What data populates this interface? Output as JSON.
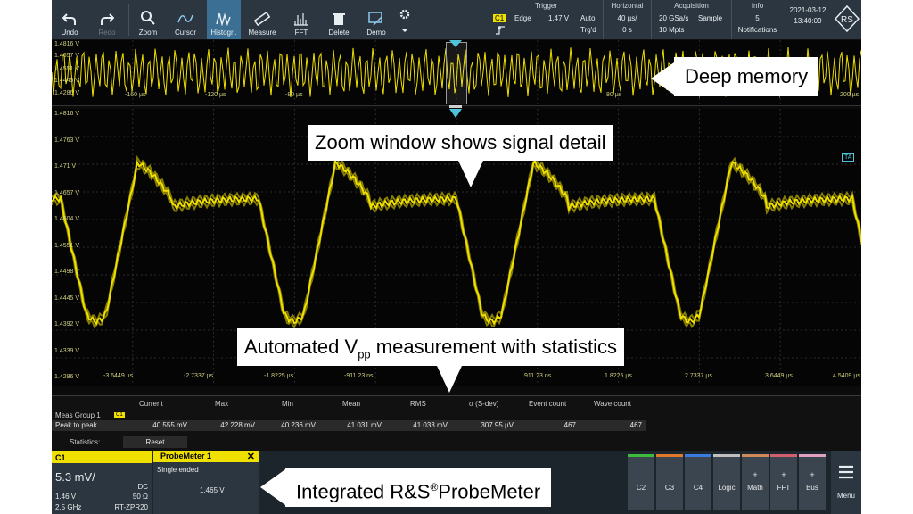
{
  "toolbar": {
    "items": [
      {
        "label": "Undo",
        "icon": "undo-icon"
      },
      {
        "label": "Redo",
        "icon": "redo-icon"
      },
      {
        "label": "Zoom",
        "icon": "zoom-icon"
      },
      {
        "label": "Cursor",
        "icon": "cursor-icon"
      },
      {
        "label": "Histogr..",
        "icon": "histogram-icon"
      },
      {
        "label": "Measure",
        "icon": "measure-icon"
      },
      {
        "label": "FFT",
        "icon": "fft-icon"
      },
      {
        "label": "Delete",
        "icon": "delete-icon"
      },
      {
        "label": "Demo",
        "icon": "demo-icon"
      }
    ]
  },
  "trigger": {
    "header": "Trigger",
    "channel": "C1",
    "type": "Edge",
    "level": "1.47 V",
    "mode": "Auto",
    "state": "Trg'd"
  },
  "horizontal": {
    "header": "Horizontal",
    "scale": "40 µs/",
    "position": "0 s"
  },
  "acquisition": {
    "header": "Acquisition",
    "rate": "20 GSa/s",
    "mode": "Sample",
    "points": "10 Mpts"
  },
  "info": {
    "header": "Info",
    "count": "5",
    "label": "Notifications"
  },
  "datetime": {
    "date": "2021-03-12",
    "time": "13:40:09"
  },
  "overview": {
    "vlabels": [
      "1.4816 V",
      "1.4657 V",
      "1.4551 V",
      "1.4445 V",
      "1.4286 V"
    ],
    "tlabels": [
      "-160 µs",
      "-120 µs",
      "-80 µs",
      "80 µs",
      "120 µs",
      "160 µs",
      "200 µs"
    ]
  },
  "main": {
    "vlabels": [
      "1.4816 V",
      "1.4763 V",
      "1.471 V",
      "1.4657 V",
      "1.4604 V",
      "1.4551 V",
      "1.4498 V",
      "1.4445 V",
      "1.4392 V",
      "1.4339 V",
      "1.4286 V"
    ],
    "tlabels": [
      "-3.6449 µs",
      "-2.7337 µs",
      "-1.8225 µs",
      "-911.23 ns",
      "911.23 ns",
      "1.8225 µs",
      "2.7337 µs",
      "3.6449 µs",
      "4.5409 µs"
    ],
    "marker": "TA"
  },
  "measurements": {
    "headers": [
      "Current",
      "Max",
      "Min",
      "Mean",
      "RMS",
      "σ (S-dev)",
      "Event count",
      "Wave count"
    ],
    "group": "Meas Group 1",
    "group_badge": "C1",
    "row_label": "Peak to peak",
    "values": [
      "40.555 mV",
      "42.228 mV",
      "40.236 mV",
      "41.031 mV",
      "41.033 mV",
      "307.95 µV",
      "467",
      "467"
    ],
    "statistics_label": "Statistics:",
    "reset_label": "Reset"
  },
  "channel1": {
    "name": "C1",
    "scale": "5.3 mV/",
    "offset": "1.46 V",
    "coupling": "DC",
    "bandwidth": "2.5 GHz",
    "impedance": "50 Ω",
    "probe": "RT-ZPR20"
  },
  "probemeter": {
    "title": "ProbeMeter 1",
    "mode": "Single ended",
    "value": "1.465 V"
  },
  "channel_buttons": [
    {
      "label": "C2",
      "color": "#3dbb3d",
      "plus": ""
    },
    {
      "label": "C3",
      "color": "#e07a2a",
      "plus": ""
    },
    {
      "label": "C4",
      "color": "#3a7be0",
      "plus": ""
    },
    {
      "label": "Logic",
      "color": "#c0c0c0",
      "plus": ""
    },
    {
      "label": "Math",
      "color": "#d08a5a",
      "plus": "+"
    },
    {
      "label": "FFT",
      "color": "#d06070",
      "plus": "+"
    },
    {
      "label": "Bus",
      "color": "#e0a0c0",
      "plus": "+"
    }
  ],
  "menu_label": "Menu",
  "callouts": {
    "deep_memory": "Deep memory",
    "zoom_window": "Zoom window shows signal detail",
    "vpp_pre": "Automated V",
    "vpp_sub": "pp",
    "vpp_post": " measurement with statistics",
    "probemeter_pre": "Integrated R&S",
    "probemeter_sup": "®",
    "probemeter_post": "ProbeMeter"
  },
  "colors": {
    "trace": "#f0e000",
    "accent": "#3b6f93",
    "panel": "#2b3640"
  }
}
